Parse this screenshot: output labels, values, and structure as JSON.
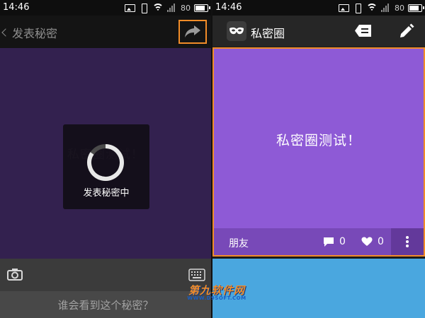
{
  "left_screen": {
    "status": {
      "time": "14:46",
      "battery": "80"
    },
    "nav": {
      "back_label": "发表秘密"
    },
    "compose": {
      "text": "私密圈测试！"
    },
    "loading": {
      "text": "发表秘密中"
    },
    "audience_prompt": "谁会看到这个秘密？"
  },
  "right_screen": {
    "status": {
      "time": "14:46",
      "battery": "80"
    },
    "app_title": "私密圈",
    "card": {
      "text": "私密圈测试！",
      "audience": "朋友",
      "comments": "0",
      "likes": "0"
    }
  },
  "watermark": {
    "main": "第九软件网",
    "sub": "WWW.D9SOFT.COM"
  },
  "colors": {
    "compose_bg": "#33214f",
    "card_bg": "#8e5ad6",
    "card2_bg": "#4aa7df",
    "highlight": "#f28c28"
  },
  "icons": [
    "back-chevron-icon",
    "share-arrow-icon",
    "camera-icon",
    "keyboard-icon",
    "mask-logo-icon",
    "message-icon",
    "pencil-icon",
    "comment-icon",
    "heart-icon",
    "more-vert-icon",
    "wifi-icon",
    "battery-icon"
  ]
}
